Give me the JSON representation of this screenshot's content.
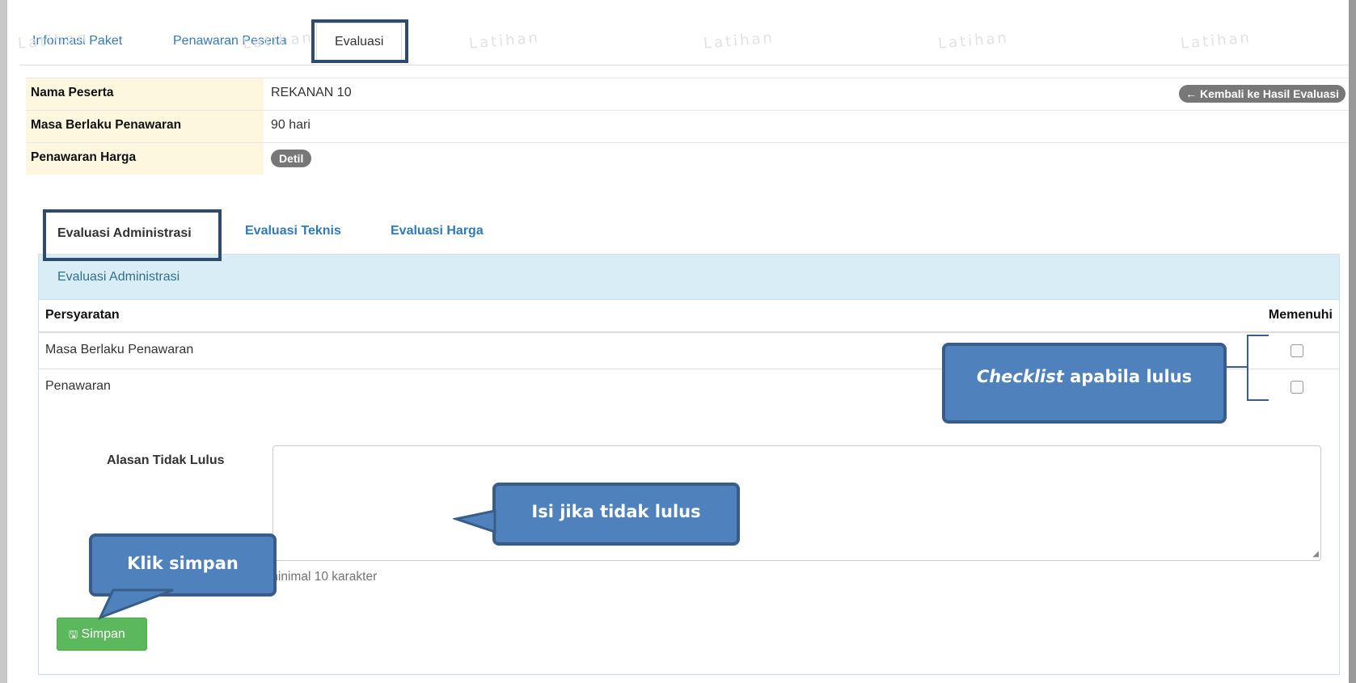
{
  "watermark": "Latihan",
  "top_tabs": [
    "Informasi Paket",
    "Penawaran Peserta",
    "Evaluasi"
  ],
  "info": [
    {
      "label": "Nama Peserta",
      "value": "REKANAN 10"
    },
    {
      "label": "Masa Berlaku Penawaran",
      "value": "90 hari"
    },
    {
      "label": "Penawaran Harga",
      "value": "Detil"
    }
  ],
  "back_button": "← Kembali ke Hasil Evaluasi",
  "sub_tabs": [
    "Evaluasi Administrasi",
    "Evaluasi Teknis",
    "Evaluasi Harga"
  ],
  "panel_title": "Evaluasi Administrasi",
  "table": {
    "col_requirement": "Persyaratan",
    "col_meets": "Memenuhi",
    "rows": [
      {
        "requirement": "Masa Berlaku Penawaran",
        "checked": false
      },
      {
        "requirement": "Penawaran",
        "checked": false
      }
    ]
  },
  "form": {
    "label": "Alasan Tidak Lulus",
    "value": "",
    "hint": "minimal 10 karakter"
  },
  "save_button": "Simpan",
  "callouts": {
    "checklist_italic": "Checklist",
    "checklist_rest": " apabila lulus",
    "isi": "Isi jika tidak lulus",
    "simpan": "Klik simpan"
  },
  "colors": {
    "accent": "#337ab7",
    "callout": "#4f81bd",
    "save": "#5cb85c",
    "highlight_border": "#2e4a6e"
  }
}
